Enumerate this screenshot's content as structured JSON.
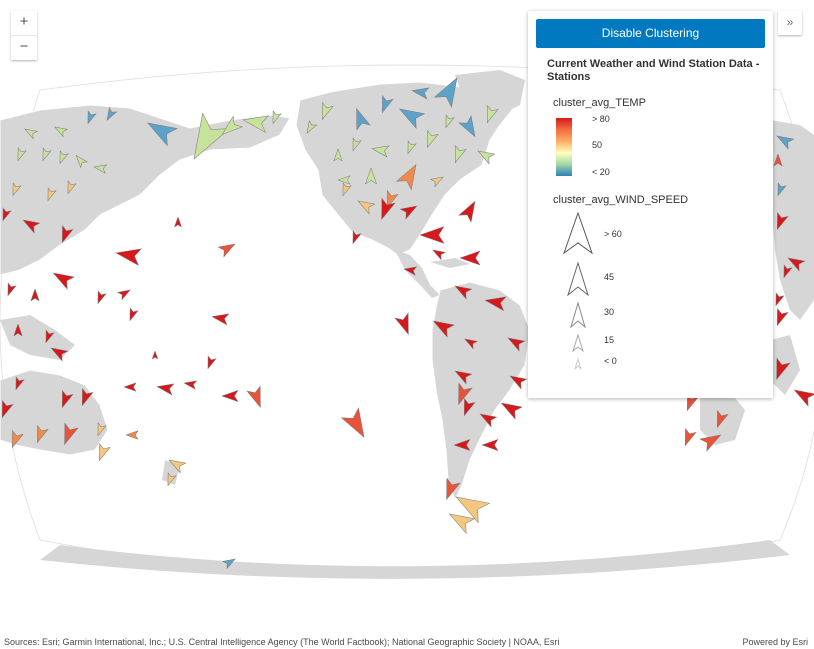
{
  "controls": {
    "zoom_in": "+",
    "zoom_out": "−",
    "expand": "»"
  },
  "legend": {
    "button_label": "Disable Clustering",
    "layer_title": "Current Weather and Wind Station Data - Stations",
    "temp_field": "cluster_avg_TEMP",
    "temp_ticks": [
      "> 80",
      "50",
      "< 20"
    ],
    "wind_field": "cluster_avg_WIND_SPEED",
    "wind_ticks": [
      "> 60",
      "45",
      "30",
      "15",
      "< 0"
    ]
  },
  "colors": {
    "land": "#d6d6d6",
    "ocean": "#ffffff",
    "button": "#0079c1",
    "temp_high": "#d7191c",
    "temp_mid": "#ffffbf",
    "temp_low": "#2b83ba"
  },
  "attribution": "Sources: Esri; Garmin International, Inc.; U.S. Central Intelligence Agency (The World Factbook); National Geographic Society | NOAA, Esri",
  "powered_by": "Powered by Esri"
}
